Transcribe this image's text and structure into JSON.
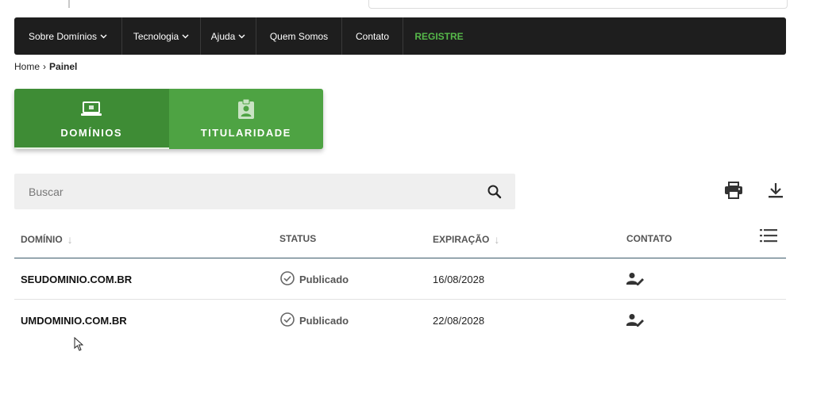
{
  "nav": {
    "items": [
      {
        "label": "Sobre Domínios",
        "has_dropdown": true
      },
      {
        "label": "Tecnologia",
        "has_dropdown": true
      },
      {
        "label": "Ajuda",
        "has_dropdown": true
      },
      {
        "label": "Quem Somos",
        "has_dropdown": false
      },
      {
        "label": "Contato",
        "has_dropdown": false
      },
      {
        "label": "REGISTRE",
        "has_dropdown": false
      }
    ],
    "chevron": "⌄",
    "register_color": "#56b84a"
  },
  "breadcrumb": {
    "home": "Home",
    "separator": "›",
    "current": "Painel"
  },
  "tabs": [
    {
      "label": "DOMÍNIOS",
      "icon": "laptop-icon",
      "active": true
    },
    {
      "label": "TITULARIDADE",
      "icon": "contact-badge-icon",
      "active": false
    }
  ],
  "search": {
    "placeholder": "Buscar",
    "value": ""
  },
  "toolbar": {
    "icons": [
      "print-icon",
      "download-icon",
      "column-list-icon"
    ]
  },
  "table": {
    "headers": {
      "domain": "DOMÍNIO",
      "status": "STATUS",
      "expiration": "EXPIRAÇÃO",
      "contact": "CONTATO",
      "sort_arrow": "↓"
    },
    "rows": [
      {
        "domain": "SEUDOMINIO.COM.BR",
        "status": "Publicado",
        "expiration": "16/08/2028"
      },
      {
        "domain": "UMDOMINIO.COM.BR",
        "status": "Publicado",
        "expiration": "22/08/2028"
      }
    ]
  },
  "colors": {
    "nav_bg": "#1e1e1e",
    "tab_active": "#3e8c35",
    "tab_inactive": "#4ea343",
    "search_bg": "#efefef"
  }
}
